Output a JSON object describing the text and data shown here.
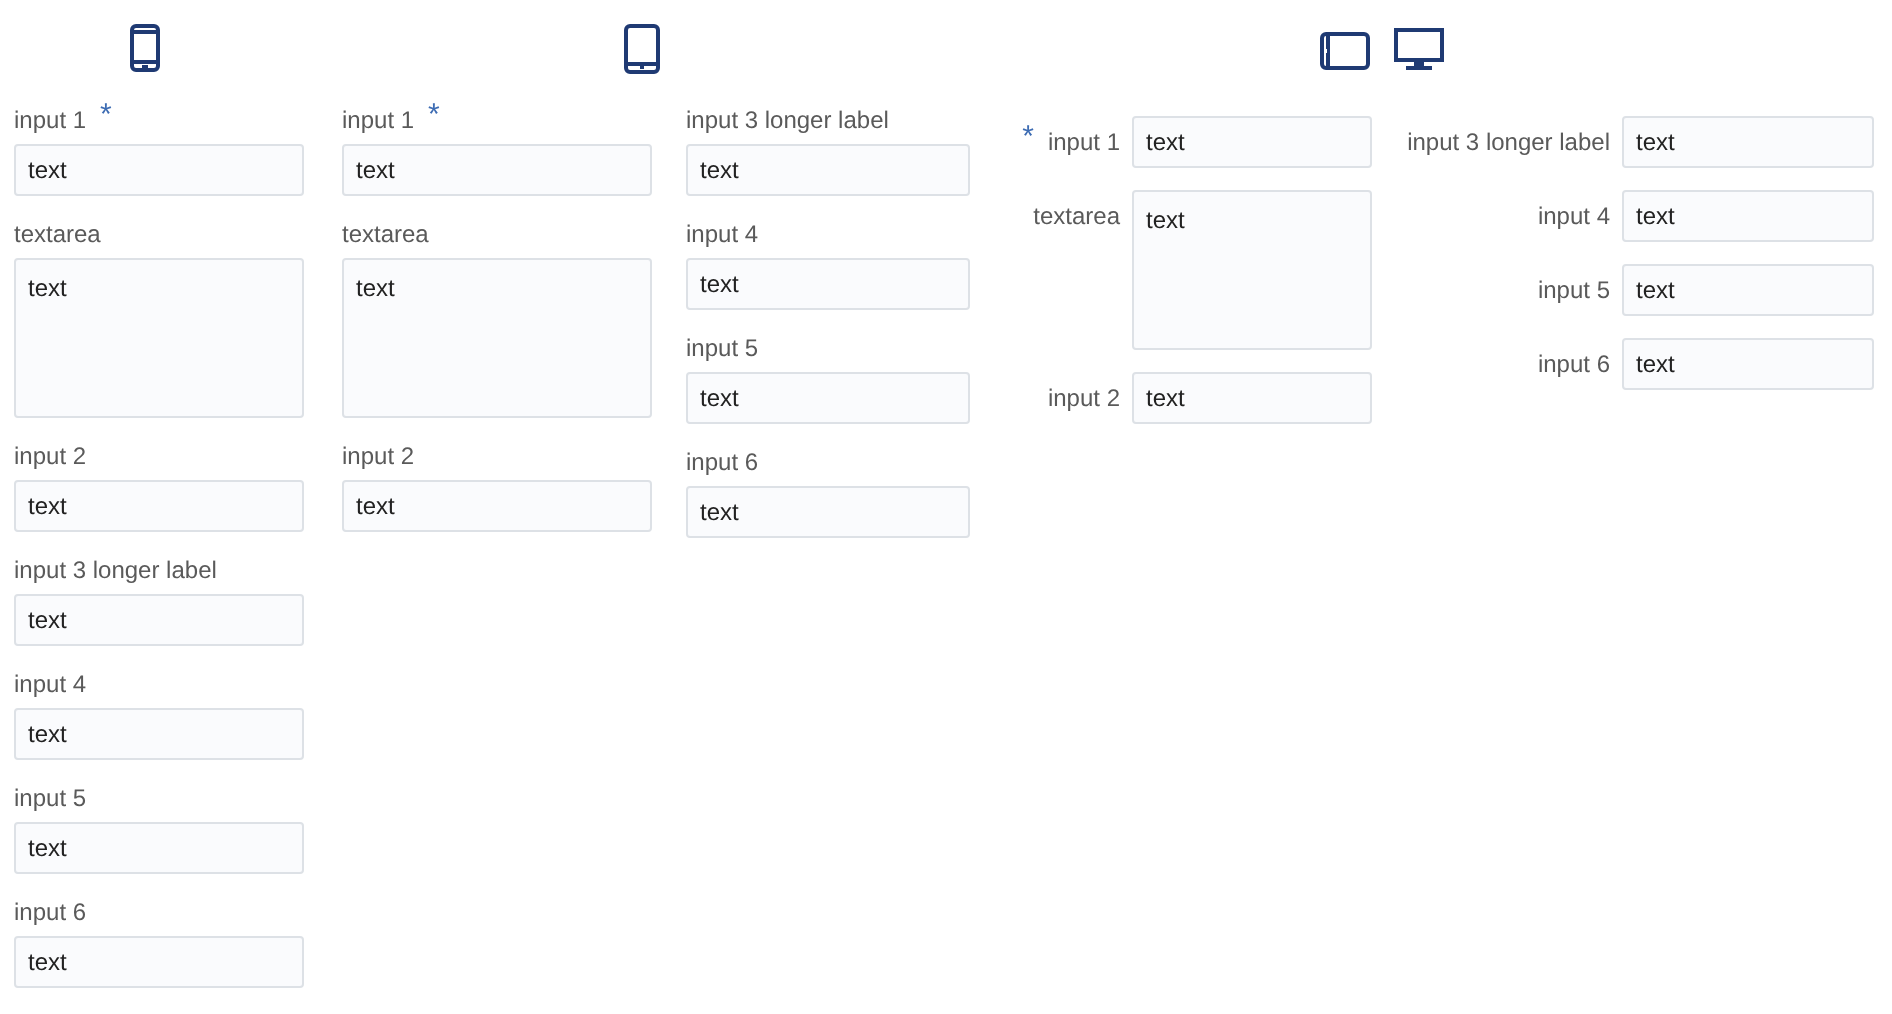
{
  "layouts": [
    {
      "kind": "phone",
      "labels_beside": false,
      "columns": [
        [
          {
            "kind": "input",
            "label": "input 1",
            "required_mark": "*",
            "value": "text"
          },
          {
            "kind": "textarea",
            "label": "textarea",
            "value": "text"
          },
          {
            "kind": "input",
            "label": "input 2",
            "value": "text"
          },
          {
            "kind": "input",
            "label": "input 3 longer label",
            "value": "text"
          },
          {
            "kind": "input",
            "label": "input 4",
            "value": "text"
          },
          {
            "kind": "input",
            "label": "input 5",
            "value": "text"
          },
          {
            "kind": "input",
            "label": "input 6",
            "value": "text"
          }
        ]
      ]
    },
    {
      "kind": "tablet",
      "labels_beside": false,
      "columns": [
        [
          {
            "kind": "input",
            "label": "input 1",
            "required_mark": "*",
            "value": "text"
          },
          {
            "kind": "textarea",
            "label": "textarea",
            "value": "text"
          },
          {
            "kind": "input",
            "label": "input 2",
            "value": "text"
          }
        ],
        [
          {
            "kind": "input",
            "label": "input 3 longer label",
            "value": "text"
          },
          {
            "kind": "input",
            "label": "input 4",
            "value": "text"
          },
          {
            "kind": "input",
            "label": "input 5",
            "value": "text"
          },
          {
            "kind": "input",
            "label": "input 6",
            "value": "text"
          }
        ]
      ]
    },
    {
      "kind": "desktop",
      "labels_beside": true,
      "columns": [
        [
          {
            "kind": "input",
            "label": "input 1",
            "required_mark": "*",
            "value": "text"
          },
          {
            "kind": "textarea",
            "label": "textarea",
            "value": "text"
          },
          {
            "kind": "input",
            "label": "input 2",
            "value": "text"
          }
        ],
        [
          {
            "kind": "input",
            "label": "input 3 longer label",
            "value": "text"
          },
          {
            "kind": "input",
            "label": "input 4",
            "value": "text"
          },
          {
            "kind": "input",
            "label": "input 5",
            "value": "text"
          },
          {
            "kind": "input",
            "label": "input 6",
            "value": "text"
          }
        ]
      ]
    }
  ]
}
